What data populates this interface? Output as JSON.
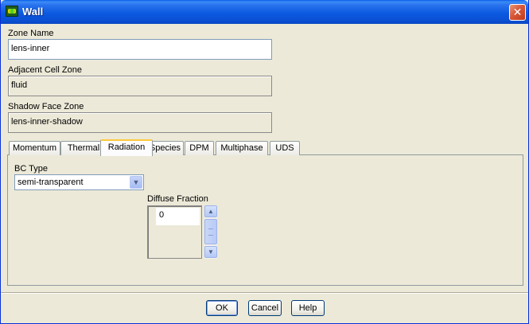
{
  "window": {
    "title": "Wall"
  },
  "fields": {
    "zone_name": {
      "label": "Zone Name",
      "value": "lens-inner"
    },
    "adjacent_cell_zone": {
      "label": "Adjacent Cell Zone",
      "value": "fluid"
    },
    "shadow_face_zone": {
      "label": "Shadow Face Zone",
      "value": "lens-inner-shadow"
    }
  },
  "tabs": [
    {
      "label": "Momentum"
    },
    {
      "label": "Thermal"
    },
    {
      "label": "Radiation",
      "active": true
    },
    {
      "label": "Species"
    },
    {
      "label": "DPM"
    },
    {
      "label": "Multiphase"
    },
    {
      "label": "UDS"
    }
  ],
  "radiation": {
    "bc_type_label": "BC Type",
    "bc_type_value": "semi-transparent",
    "diffuse_fraction_label": "Diffuse Fraction",
    "diffuse_fraction_value": "0"
  },
  "buttons": {
    "ok": "OK",
    "cancel": "Cancel",
    "help": "Help"
  },
  "colors": {
    "titlebar": "#0a5fe8",
    "dialog_bg": "#ece9d8",
    "active_tab_accent": "#ffc83c"
  }
}
